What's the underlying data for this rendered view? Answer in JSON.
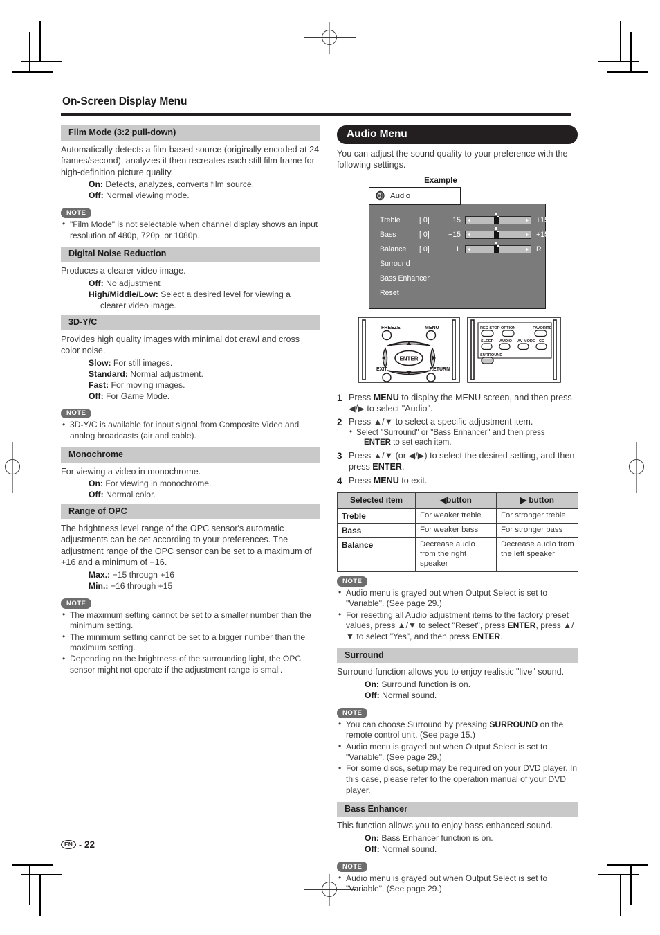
{
  "page": {
    "title": "On-Screen Display Menu",
    "footer": {
      "language": "EN",
      "separator": "-",
      "number": "22"
    }
  },
  "left_column": {
    "sections": [
      {
        "heading": "Film Mode (3:2 pull-down)",
        "body": "Automatically detects a film-based source (originally encoded at 24 frames/second), analyzes it then recreates each still film frame for high-definition picture quality.",
        "definitions": [
          {
            "term": "On:",
            "desc": "Detects, analyzes, converts film source."
          },
          {
            "term": "Off:",
            "desc": "Normal viewing mode."
          }
        ],
        "note_label": "NOTE",
        "notes": [
          "\"Film Mode\" is not selectable when channel display shows an input resolution of 480p, 720p, or 1080p."
        ]
      },
      {
        "heading": "Digital Noise Reduction",
        "body": "Produces a clearer video image.",
        "definitions": [
          {
            "term": "Off:",
            "desc": "No adjustment"
          },
          {
            "term": "High/Middle/Low:",
            "desc": "Select a desired level for viewing a",
            "cont": "clearer video image."
          }
        ]
      },
      {
        "heading": "3D-Y/C",
        "body": "Provides high quality images with minimal dot crawl and cross color noise.",
        "definitions": [
          {
            "term": "Slow:",
            "desc": "For still images."
          },
          {
            "term": "Standard:",
            "desc": "Normal adjustment."
          },
          {
            "term": "Fast:",
            "desc": "For moving images."
          },
          {
            "term": "Off:",
            "desc": "For Game Mode."
          }
        ],
        "note_label": "NOTE",
        "notes": [
          "3D-Y/C is available for input signal from Composite Video and analog broadcasts (air and cable)."
        ]
      },
      {
        "heading": "Monochrome",
        "body": "For viewing a video in monochrome.",
        "definitions": [
          {
            "term": "On:",
            "desc": "For viewing in monochrome."
          },
          {
            "term": "Off:",
            "desc": "Normal color."
          }
        ]
      },
      {
        "heading": "Range of OPC",
        "body": "The brightness level range of the OPC sensor's automatic adjustments can be set according to your preferences. The adjustment range of the OPC sensor can be set to a maximum of +16 and a minimum of −16.",
        "definitions": [
          {
            "term": "Max.:",
            "desc": "−15 through +16"
          },
          {
            "term": "Min.:",
            "desc": "−16 through +15"
          }
        ],
        "note_label": "NOTE",
        "notes": [
          "The maximum setting cannot be set to a smaller number than the minimum setting.",
          "The minimum setting cannot be set to a bigger number than the maximum setting.",
          "Depending on the brightness of the surrounding light, the OPC sensor might not operate if the adjustment range is small."
        ]
      }
    ]
  },
  "right_column": {
    "banner": "Audio Menu",
    "intro": "You can adjust the sound quality to your preference with the following settings.",
    "example_label": "Example",
    "osd": {
      "tab_label": "Audio",
      "rows": [
        {
          "name": "Treble",
          "value": "[ 0]",
          "min": "−15",
          "max": "+15",
          "slider": true
        },
        {
          "name": "Bass",
          "value": "[ 0]",
          "min": "−15",
          "max": "+15",
          "slider": true
        },
        {
          "name": "Balance",
          "value": "[ 0]",
          "min": "L",
          "max": "R",
          "slider": true
        },
        {
          "name": "Surround",
          "value": "",
          "min": "",
          "max": "",
          "slider": false
        },
        {
          "name": "Bass Enhancer",
          "value": "",
          "min": "",
          "max": "",
          "slider": false
        },
        {
          "name": "Reset",
          "value": "",
          "min": "",
          "max": "",
          "slider": false
        }
      ]
    },
    "remote_left": {
      "buttons": [
        "FREEZE",
        "MENU",
        "EXIT",
        "RETURN"
      ],
      "center_label": "ENTER"
    },
    "remote_right": {
      "buttons": [
        "REC STOP",
        "OPTION",
        "FAVORITE",
        "SLEEP",
        "AUDIO",
        "AV MODE",
        "CC",
        "SURROUND"
      ]
    },
    "steps": [
      {
        "num": "1",
        "html": "Press <span class=\"b\">MENU</span> to display the MENU screen, and then press ◀/▶ to select \"Audio\"."
      },
      {
        "num": "2",
        "html": "Press ▲/▼ to select a specific adjustment item.",
        "sub_html": "Select \"Surround\" or \"Bass Enhancer\" and then press <span class=\"cont\"><span class=\"b\">ENTER</span> to set each item.</span>"
      },
      {
        "num": "3",
        "html": "Press ▲/▼ (or ◀/▶) to select the desired setting, and then press <span class=\"b\">ENTER</span>."
      },
      {
        "num": "4",
        "html": "Press <span class=\"b\">MENU</span> to exit."
      }
    ],
    "table": {
      "headers": [
        "Selected item",
        "◀button",
        "▶ button"
      ],
      "rows": [
        {
          "item": "Treble",
          "left": "For weaker treble",
          "right": "For stronger treble"
        },
        {
          "item": "Bass",
          "left": "For weaker bass",
          "right": "For stronger bass"
        },
        {
          "item": "Balance",
          "left": "Decrease audio from the right speaker",
          "right": "Decrease audio from the left speaker"
        }
      ]
    },
    "audio_notes": {
      "label": "NOTE",
      "items": [
        {
          "html": "Audio menu is grayed out when Output Select is set to \"Variable\". (See page 29.)"
        },
        {
          "html": "For resetting all Audio adjustment items to the factory preset values, press ▲/▼ to select \"Reset\", press <span class=\"b\">ENTER</span>, press ▲/▼ to select \"Yes\", and then press <span class=\"b\">ENTER</span>."
        }
      ]
    },
    "surround": {
      "heading": "Surround",
      "body": "Surround function allows you to enjoy realistic \"live\" sound.",
      "definitions": [
        {
          "term": "On:",
          "desc": "Surround function is on."
        },
        {
          "term": "Off:",
          "desc": "Normal sound."
        }
      ],
      "note_label": "NOTE",
      "notes": [
        {
          "html": "You can choose Surround by pressing <span class=\"b\">SURROUND</span> on the remote control unit. (See page 15.)"
        },
        {
          "html": "Audio menu is grayed out when Output Select is set to \"Variable\". (See page 29.)"
        },
        {
          "html": "For some discs, setup may be required on your DVD player. In this case, please refer to the operation manual of your DVD player."
        }
      ]
    },
    "bass_enhancer": {
      "heading": "Bass Enhancer",
      "body": "This function allows you to enjoy bass-enhanced sound.",
      "definitions": [
        {
          "term": "On:",
          "desc": "Bass Enhancer function is on."
        },
        {
          "term": "Off:",
          "desc": "Normal sound."
        }
      ],
      "note_label": "NOTE",
      "notes": [
        {
          "html": "Audio menu is grayed out when Output Select is set to \"Variable\". (See page 29.)"
        }
      ]
    }
  },
  "colors": {
    "section_header_bg": "#c9c9c9",
    "banner_bg": "#231f20",
    "note_badge_bg": "#6d6d6d",
    "osd_bg": "#7b7b7b",
    "slider_track": "#bdbdbd"
  }
}
